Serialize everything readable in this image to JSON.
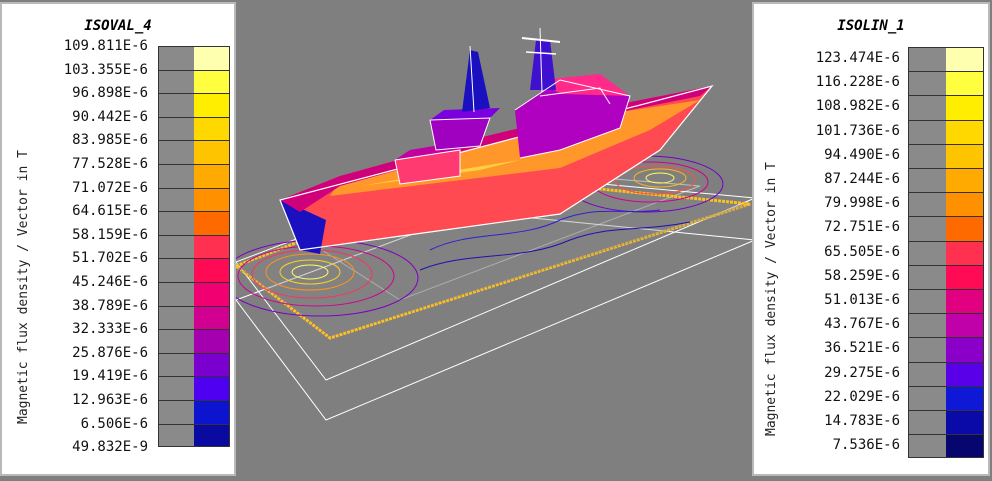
{
  "left_legend": {
    "title": "ISOVAL_4",
    "axis_label": "Magnetic flux density / Vector in T",
    "labels": [
      "109.811E-6",
      "103.355E-6",
      "96.898E-6",
      "90.442E-6",
      "83.985E-6",
      "77.528E-6",
      "71.072E-6",
      "64.615E-6",
      "58.159E-6",
      "51.702E-6",
      "45.246E-6",
      "38.789E-6",
      "32.333E-6",
      "25.876E-6",
      "19.419E-6",
      "12.963E-6",
      "6.506E-6",
      "49.832E-9"
    ],
    "colors": [
      "#ffffb0",
      "#ffff40",
      "#ffee00",
      "#ffd800",
      "#ffc400",
      "#ffaa00",
      "#ff9000",
      "#ff6a00",
      "#ff3050",
      "#ff0a55",
      "#f00070",
      "#d20090",
      "#a400b0",
      "#7a00d0",
      "#5000f0",
      "#0d14d0",
      "#0a0aa0",
      "#040478"
    ]
  },
  "right_legend": {
    "title": "ISOLIN_1",
    "axis_label": "Magnetic flux density / Vector in T",
    "labels": [
      "123.474E-6",
      "116.228E-6",
      "108.982E-6",
      "101.736E-6",
      "94.490E-6",
      "87.244E-6",
      "79.998E-6",
      "72.751E-6",
      "65.505E-6",
      "58.259E-6",
      "51.013E-6",
      "43.767E-6",
      "36.521E-6",
      "29.275E-6",
      "22.029E-6",
      "14.783E-6",
      "7.536E-6"
    ],
    "colors": [
      "#ffffb0",
      "#ffff40",
      "#ffee00",
      "#ffd800",
      "#ffc400",
      "#ffaa00",
      "#ff9000",
      "#ff6a00",
      "#ff3050",
      "#ff0a55",
      "#e00080",
      "#c000a8",
      "#8a00c8",
      "#5a00e8",
      "#1018d8",
      "#0a0aa8",
      "#06066e"
    ]
  },
  "scene": {
    "background": "#7f7f7f",
    "ship_colors": {
      "hull": "#ff4a52",
      "hot": "#ffaa22",
      "deck": "#b000c0",
      "mast": "#1a10c0"
    },
    "plate_outline": "#ffc020"
  }
}
